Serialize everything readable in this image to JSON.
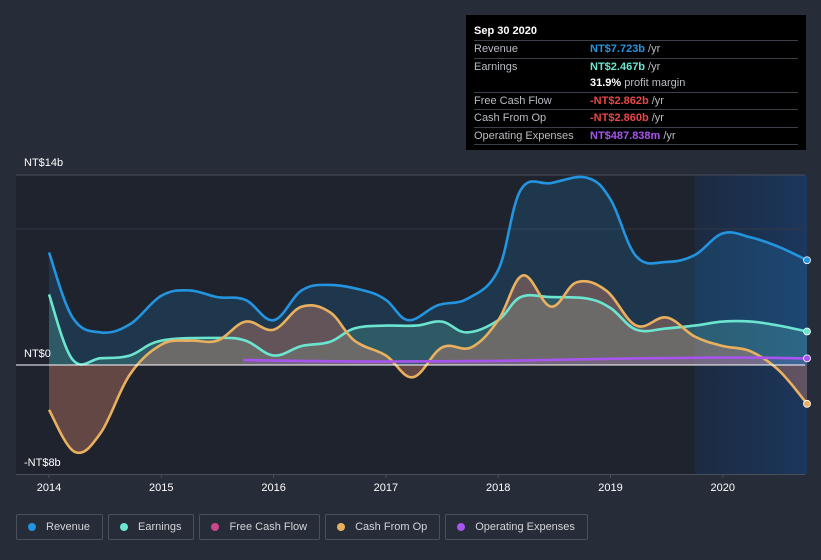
{
  "tooltip": {
    "date": "Sep 30 2020",
    "rows": [
      {
        "label": "Revenue",
        "value": "NT$7.723b",
        "unit": "/yr",
        "color": "#2394df"
      },
      {
        "label": "Earnings",
        "value": "NT$2.467b",
        "unit": "/yr",
        "color": "#6ce5d0"
      },
      {
        "label": "",
        "value": "31.9%",
        "unit": "profit margin",
        "color": "#ffffff"
      },
      {
        "label": "Free Cash Flow",
        "value": "-NT$2.862b",
        "unit": "/yr",
        "color": "#e64848"
      },
      {
        "label": "Cash From Op",
        "value": "-NT$2.860b",
        "unit": "/yr",
        "color": "#e64848"
      },
      {
        "label": "Operating Expenses",
        "value": "NT$487.838m",
        "unit": "/yr",
        "color": "#a855f0"
      }
    ]
  },
  "legend": [
    {
      "label": "Revenue",
      "color": "#2394df"
    },
    {
      "label": "Earnings",
      "color": "#6ce5d0"
    },
    {
      "label": "Free Cash Flow",
      "color": "#c9478a"
    },
    {
      "label": "Cash From Op",
      "color": "#e9b15f"
    },
    {
      "label": "Operating Expenses",
      "color": "#a855f0"
    }
  ],
  "chart_data": {
    "type": "area",
    "title": "",
    "xlabel": "",
    "ylabel": "",
    "y_labels": {
      "top": "NT$14b",
      "zero": "NT$0",
      "bottom": "-NT$8b"
    },
    "ylim": [
      -8,
      14
    ],
    "xlim": [
      2014,
      2020.75
    ],
    "x_ticks": [
      "2014",
      "2015",
      "2016",
      "2017",
      "2018",
      "2019",
      "2020"
    ],
    "highlight_from": 2019.75,
    "series": [
      {
        "name": "Revenue",
        "color": "#2394df",
        "x": [
          2014.0,
          2014.21,
          2014.46,
          2014.72,
          2015.0,
          2015.25,
          2015.5,
          2015.75,
          2016.0,
          2016.25,
          2016.5,
          2016.8,
          2017.0,
          2017.2,
          2017.46,
          2017.73,
          2018.0,
          2018.2,
          2018.47,
          2018.79,
          2019.0,
          2019.23,
          2019.5,
          2019.75,
          2020.0,
          2020.25,
          2020.5,
          2020.75
        ],
        "values": [
          8.3,
          3.5,
          2.4,
          3.0,
          5.1,
          5.5,
          5.0,
          4.8,
          3.3,
          5.5,
          5.9,
          5.5,
          4.8,
          3.3,
          4.4,
          4.9,
          7.0,
          12.9,
          13.4,
          13.8,
          12.2,
          8.0,
          7.6,
          8.1,
          9.7,
          9.4,
          8.7,
          7.72
        ]
      },
      {
        "name": "Earnings",
        "color": "#6ce5d0",
        "x": [
          2014.0,
          2014.21,
          2014.46,
          2014.72,
          2015.0,
          2015.5,
          2015.75,
          2016.0,
          2016.25,
          2016.5,
          2016.72,
          2017.0,
          2017.27,
          2017.5,
          2017.72,
          2018.0,
          2018.2,
          2018.47,
          2018.79,
          2019.0,
          2019.23,
          2019.5,
          2019.75,
          2020.0,
          2020.25,
          2020.5,
          2020.75
        ],
        "values": [
          5.2,
          0.4,
          0.5,
          0.7,
          1.8,
          2.0,
          1.8,
          0.7,
          1.4,
          1.7,
          2.7,
          2.9,
          2.9,
          3.2,
          2.4,
          3.3,
          5.0,
          5.0,
          4.9,
          4.2,
          2.6,
          2.7,
          2.9,
          3.2,
          3.2,
          2.9,
          2.47
        ]
      },
      {
        "name": "Free Cash Flow",
        "color": "#c9478a",
        "x": [
          2014.0,
          2014.23,
          2014.46,
          2014.72,
          2015.0,
          2015.25,
          2015.5,
          2015.75,
          2016.0,
          2016.25,
          2016.5,
          2016.72,
          2017.0,
          2017.24,
          2017.5,
          2017.76,
          2018.0,
          2018.22,
          2018.47,
          2018.7,
          2018.96,
          2019.23,
          2019.5,
          2019.75,
          2020.0,
          2020.25,
          2020.5,
          2020.75
        ],
        "values": [
          -3.3,
          -6.4,
          -5.0,
          -0.7,
          1.5,
          1.8,
          1.8,
          3.2,
          2.6,
          4.3,
          3.9,
          1.8,
          0.7,
          -0.9,
          1.3,
          1.3,
          3.3,
          6.6,
          4.3,
          6.1,
          5.5,
          2.9,
          3.5,
          2.1,
          1.4,
          1.0,
          -0.4,
          -2.86
        ]
      },
      {
        "name": "Cash From Op",
        "color": "#e9b15f",
        "x": [
          2014.0,
          2014.23,
          2014.46,
          2014.72,
          2015.0,
          2015.25,
          2015.5,
          2015.75,
          2016.0,
          2016.25,
          2016.5,
          2016.72,
          2017.0,
          2017.24,
          2017.5,
          2017.76,
          2018.0,
          2018.22,
          2018.47,
          2018.7,
          2018.96,
          2019.23,
          2019.5,
          2019.75,
          2020.0,
          2020.25,
          2020.5,
          2020.75
        ],
        "values": [
          -3.3,
          -6.4,
          -5.0,
          -0.7,
          1.5,
          1.8,
          1.8,
          3.2,
          2.6,
          4.3,
          3.9,
          1.8,
          0.7,
          -0.9,
          1.3,
          1.3,
          3.3,
          6.6,
          4.3,
          6.1,
          5.5,
          2.9,
          3.5,
          2.1,
          1.4,
          1.0,
          -0.4,
          -2.86
        ]
      },
      {
        "name": "Operating Expenses",
        "color": "#a855f0",
        "x": [
          2015.73,
          2016.25,
          2017.0,
          2018.0,
          2018.92,
          2020.0,
          2020.75
        ],
        "values": [
          0.37,
          0.3,
          0.25,
          0.3,
          0.45,
          0.55,
          0.49
        ]
      }
    ]
  }
}
